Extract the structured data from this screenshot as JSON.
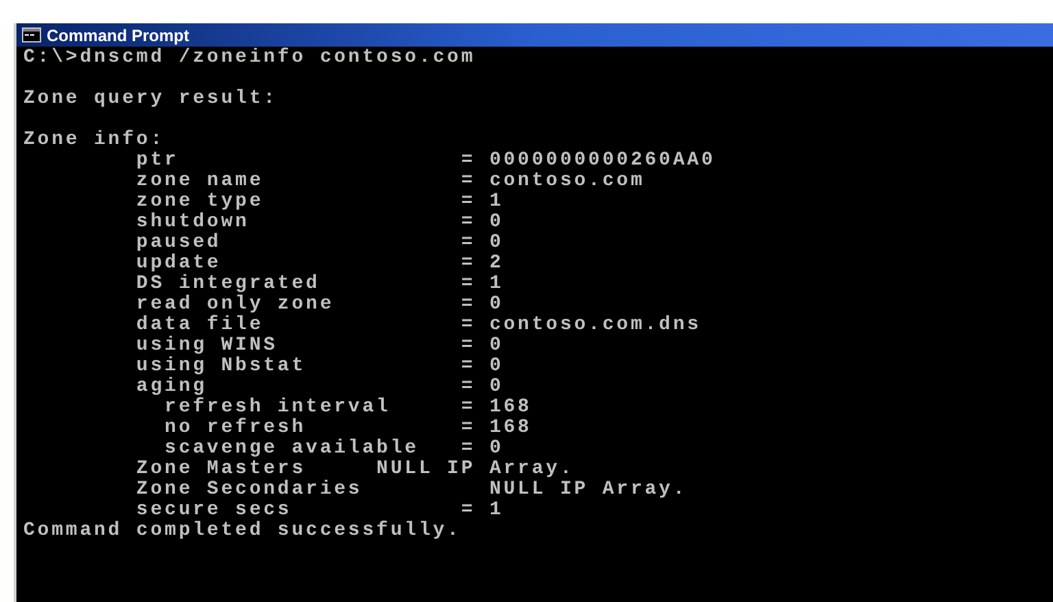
{
  "window": {
    "title": "Command Prompt"
  },
  "console_blocks": [
    [
      "C:\\>dnscmd /zoneinfo contoso.com"
    ],
    [
      "Zone query result:"
    ],
    [
      "Zone info:",
      "        ptr                    = 0000000000260AA0",
      "        zone name              = contoso.com",
      "        zone type              = 1",
      "        shutdown               = 0",
      "        paused                 = 0",
      "        update                 = 2",
      "        DS integrated          = 1",
      "        read only zone         = 0",
      "        data file              = contoso.com.dns",
      "        using WINS             = 0",
      "        using Nbstat           = 0",
      "        aging                  = 0",
      "          refresh interval     = 168",
      "          no refresh           = 168",
      "          scavenge available   = 0",
      "        Zone Masters     NULL IP Array.",
      "        Zone Secondaries         NULL IP Array.",
      "        secure secs            = 1",
      "Command completed successfully."
    ]
  ]
}
